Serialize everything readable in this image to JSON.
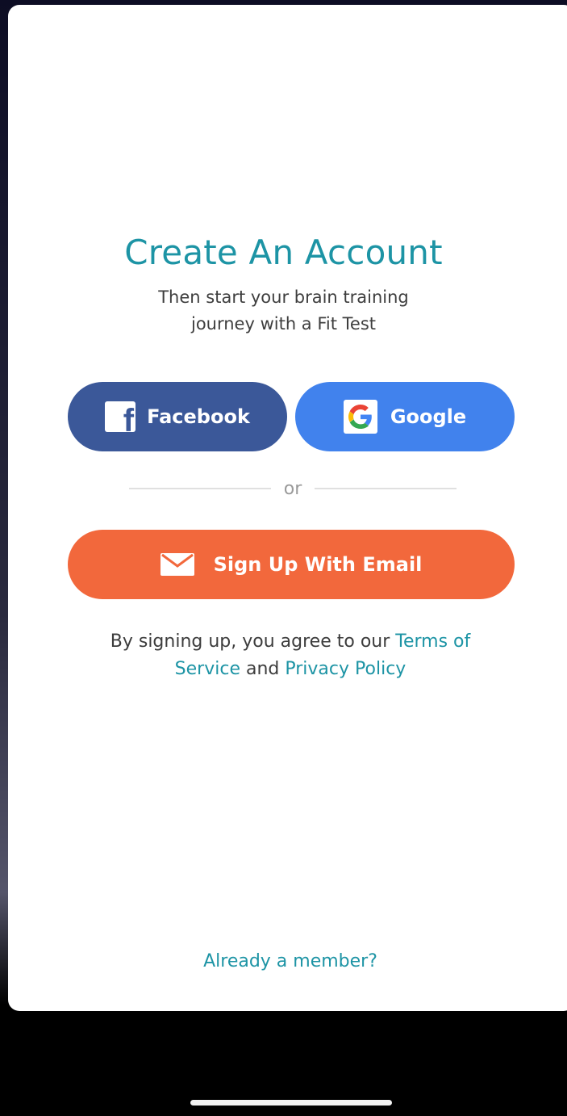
{
  "header": {
    "title": "Create An Account",
    "subtitle_line1": "Then start your brain training",
    "subtitle_line2": "journey with a Fit Test"
  },
  "social": {
    "facebook_label": "Facebook",
    "google_label": "Google",
    "facebook_color": "#3b5899",
    "google_color": "#4182ed"
  },
  "divider": {
    "label": "or"
  },
  "email_button": {
    "label": "Sign Up With Email",
    "color": "#f2683c"
  },
  "legal": {
    "prefix": "By signing up, you agree to our ",
    "terms_part1": "Terms of",
    "terms_part2": "Service",
    "and": " and ",
    "privacy": "Privacy Policy"
  },
  "footer": {
    "member_link": "Already a member?"
  },
  "colors": {
    "accent": "#1d94a5"
  }
}
